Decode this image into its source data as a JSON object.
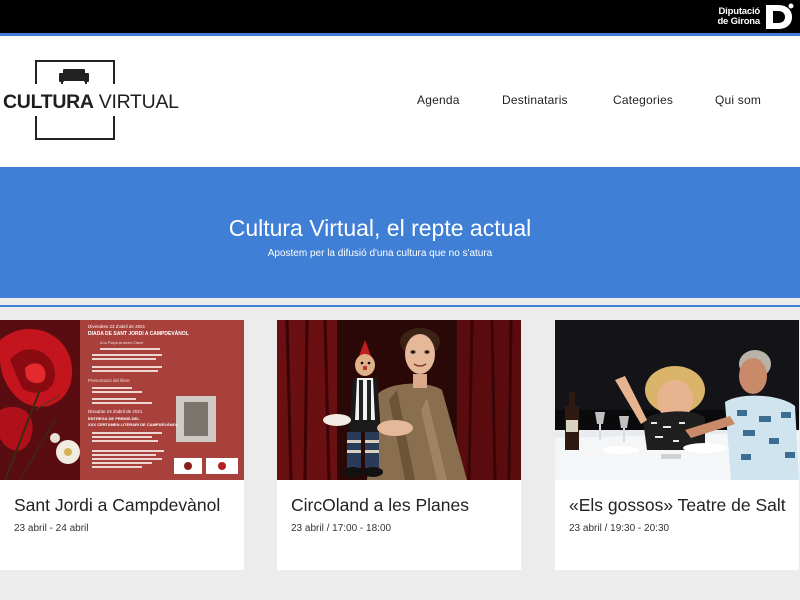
{
  "topbar": {
    "brand_line1": "Diputació",
    "brand_line2": "de Girona"
  },
  "logo": {
    "bold": "CULTURA",
    "light": " VIRTUAL"
  },
  "nav": [
    {
      "label": "Agenda"
    },
    {
      "label": "Destinataris"
    },
    {
      "label": "Categories"
    },
    {
      "label": "Qui som"
    }
  ],
  "hero": {
    "title": "Cultura Virtual, el repte actual",
    "subtitle": "Apostem per la difusió d'una cultura que no s'atura"
  },
  "cards": [
    {
      "title": "Sant Jordi a Campdevànol",
      "date": "23 abril - 24 abril",
      "poster": {
        "l1": "Divendres 23 d'abril de 2021",
        "l2": "DIADA DE SANT JORDI A CAMPDEVÀNOL",
        "l3": "A la Plaça Anselm Clavé",
        "l4": "Presentació del llibre",
        "l5": "Dissabte 24 d'abril de 2021",
        "l6": "ENTREGA DE PREMIS DEL",
        "l7": "XXX CERTAMEN LITERARI DE CAMPDEVÀNOL"
      }
    },
    {
      "title": "CircOland a les Planes",
      "date": "23 abril / 17:00 - 18:00"
    },
    {
      "title": "«Els gossos» Teatre de Salt",
      "date": "23 abril / 19:30 - 20:30"
    }
  ],
  "colors": {
    "accent": "#3f7fd6",
    "topbar": "#000000",
    "background": "#ececec"
  }
}
